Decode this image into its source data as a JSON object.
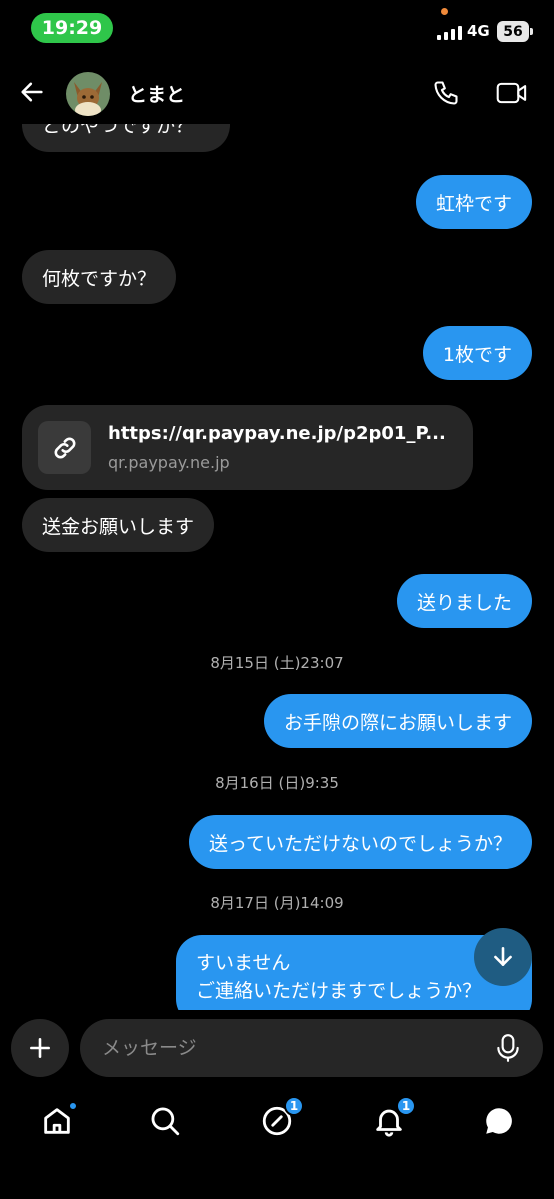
{
  "status": {
    "time": "19:29",
    "network": "4G",
    "battery": "56"
  },
  "header": {
    "contact_name": "とまと"
  },
  "messages": {
    "m0": "どのやつですか？",
    "m1": "虹枠です",
    "m2": "何枚ですか？",
    "m3": "1枚です",
    "link": {
      "url": "https://qr.paypay.ne.jp/p2p01_P...",
      "domain": "qr.paypay.ne.jp"
    },
    "m4": "送金お願いします",
    "m5": "送りました",
    "t1": "8月15日 (土)23:07",
    "m6": "お手隙の際にお願いします",
    "t2": "8月16日 (日)9:35",
    "m7": "送っていただけないのでしょうか？",
    "t3": "8月17日 (月)14:09",
    "m8_line1": "すいません",
    "m8_line2": "ご連絡いただけますでしょうか？"
  },
  "composer": {
    "placeholder": "メッセージ"
  },
  "tabs": {
    "explore_badge": "1",
    "notifications_badge": "1"
  },
  "colors": {
    "outgoing": "#2996f0",
    "incoming": "#262626",
    "status_pill": "#2fc64a"
  }
}
